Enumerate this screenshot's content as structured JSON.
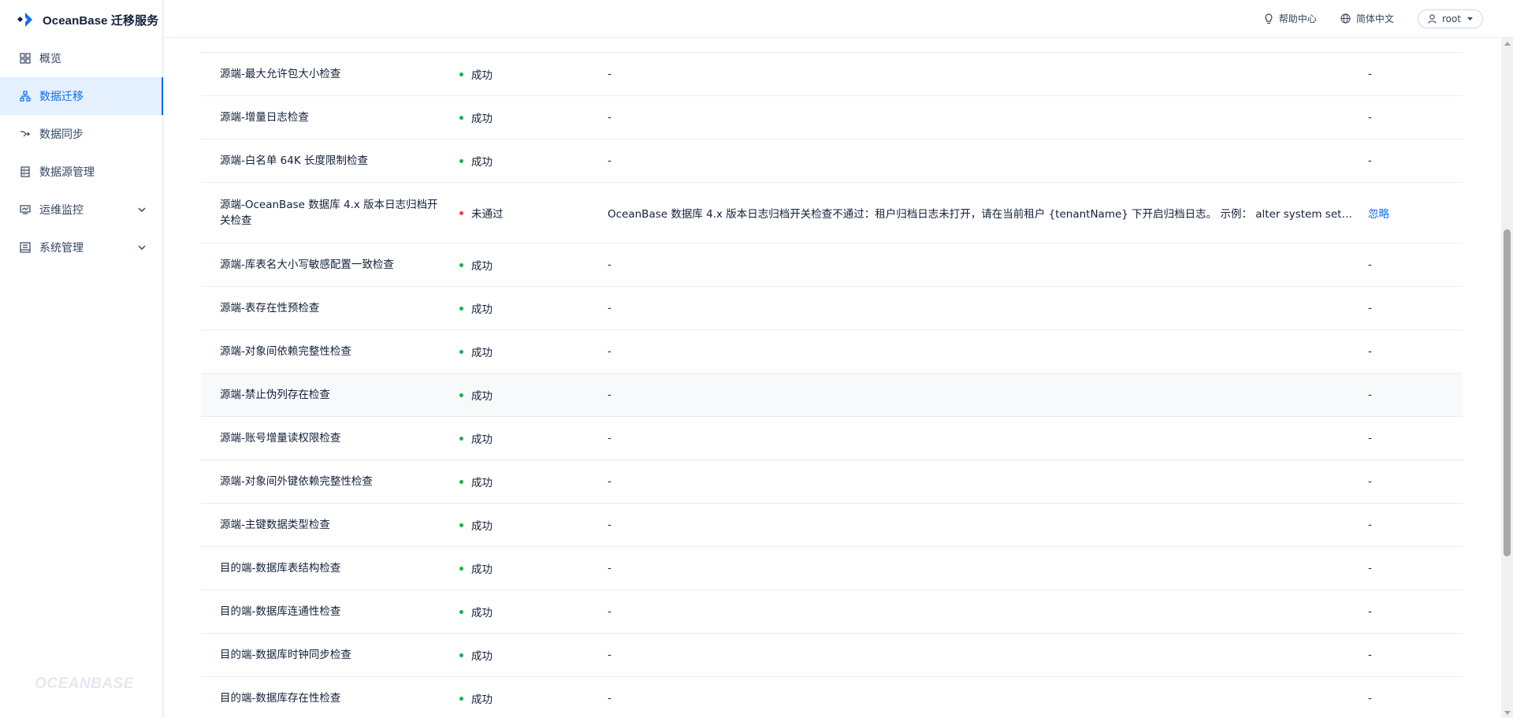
{
  "brand": {
    "name": "OceanBase 迁移服务"
  },
  "sidebar": {
    "items": [
      {
        "label": "概览",
        "icon": "overview-grid-icon"
      },
      {
        "label": "数据迁移",
        "icon": "data-migration-icon",
        "active": true
      },
      {
        "label": "数据同步",
        "icon": "data-sync-icon"
      },
      {
        "label": "数据源管理",
        "icon": "datasource-icon"
      },
      {
        "label": "运维监控",
        "icon": "monitor-icon",
        "expandable": true
      },
      {
        "label": "系统管理",
        "icon": "system-icon",
        "expandable": true
      }
    ],
    "footer_logo": "OCEANBASE"
  },
  "header": {
    "help_label": "帮助中心",
    "language_label": "简体中文",
    "user_label": "root"
  },
  "table": {
    "rows": [
      {
        "name": "源端-最大允许包大小检查",
        "status": "成功",
        "message": "-",
        "action": "-"
      },
      {
        "name": "源端-增量日志检查",
        "status": "成功",
        "message": "-",
        "action": "-"
      },
      {
        "name": "源端-白名单 64K 长度限制检查",
        "status": "成功",
        "message": "-",
        "action": "-"
      },
      {
        "name": "源端-OceanBase 数据库 4.x 版本日志归档开关检查",
        "status": "未通过",
        "message": "OceanBase 数据库 4.x 版本日志归档开关检查不通过：租户归档日志未打开，请在当前租户 {tenantName} 下开启归档日志。 示例： alter system set l...",
        "action": "忽略"
      },
      {
        "name": "源端-库表名大小写敏感配置一致检查",
        "status": "成功",
        "message": "-",
        "action": "-"
      },
      {
        "name": "源端-表存在性预检查",
        "status": "成功",
        "message": "-",
        "action": "-"
      },
      {
        "name": "源端-对象间依赖完整性检查",
        "status": "成功",
        "message": "-",
        "action": "-"
      },
      {
        "name": "源端-禁止伪列存在检查",
        "status": "成功",
        "message": "-",
        "action": "-"
      },
      {
        "name": "源端-账号增量读权限检查",
        "status": "成功",
        "message": "-",
        "action": "-"
      },
      {
        "name": "源端-对象间外键依赖完整性检查",
        "status": "成功",
        "message": "-",
        "action": "-"
      },
      {
        "name": "源端-主键数据类型检查",
        "status": "成功",
        "message": "-",
        "action": "-"
      },
      {
        "name": "目的端-数据库表结构检查",
        "status": "成功",
        "message": "-",
        "action": "-"
      },
      {
        "name": "目的端-数据库连通性检查",
        "status": "成功",
        "message": "-",
        "action": "-"
      },
      {
        "name": "目的端-数据库时钟同步检查",
        "status": "成功",
        "message": "-",
        "action": "-"
      },
      {
        "name": "目的端-数据库存在性检查",
        "status": "成功",
        "message": "-",
        "action": "-"
      }
    ]
  },
  "colors": {
    "primary": "#0d6cf2",
    "success": "#16b24b",
    "fail": "#f0414c",
    "text": "#132039"
  }
}
